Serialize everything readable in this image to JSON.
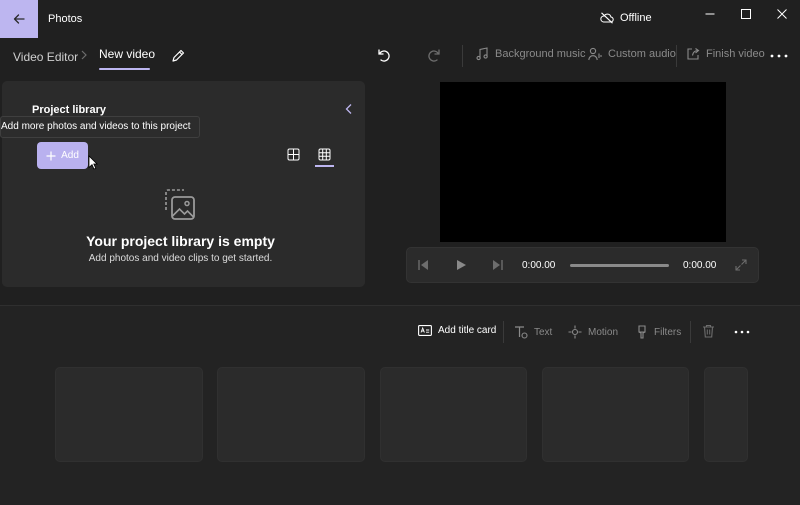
{
  "app": {
    "title": "Photos",
    "status": "Offline"
  },
  "breadcrumb": {
    "root": "Video Editor",
    "current": "New video"
  },
  "toolbar": {
    "background_music": "Background music",
    "custom_audio": "Custom audio",
    "finish_video": "Finish video"
  },
  "library": {
    "title": "Project library",
    "tooltip": "Add more photos and videos to this project",
    "add_label": "Add",
    "empty_title": "Your project library is empty",
    "empty_subtitle": "Add photos and video clips to get started."
  },
  "player": {
    "current_time": "0:00.00",
    "total_time": "0:00.00"
  },
  "storyboard": {
    "add_title_card": "Add title card",
    "text": "Text",
    "motion": "Motion",
    "filters": "Filters"
  },
  "colors": {
    "accent": "#bdb6f0",
    "background": "#202020",
    "panel": "#2b2b2b"
  }
}
